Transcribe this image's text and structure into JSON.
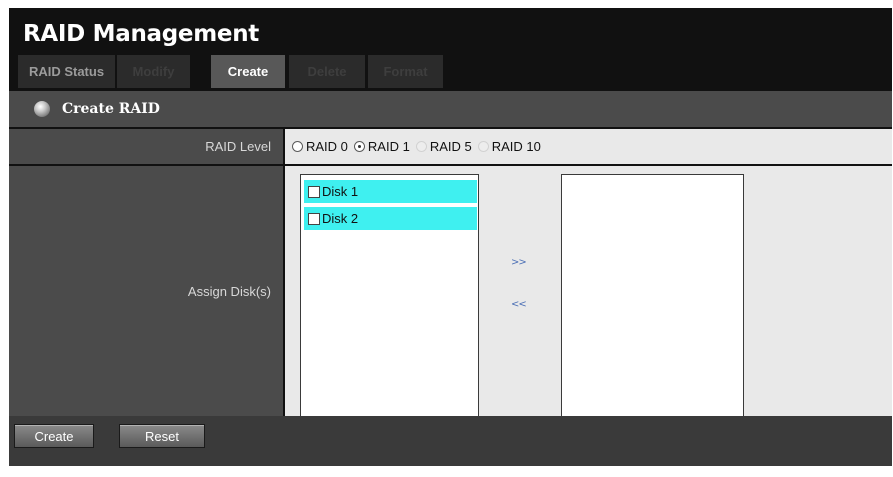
{
  "page": {
    "title": "RAID Management"
  },
  "tabs": [
    {
      "label": "RAID Status",
      "state": "normal"
    },
    {
      "label": "Modify",
      "state": "disabled"
    },
    {
      "label": "Create",
      "state": "active"
    },
    {
      "label": "Delete",
      "state": "disabled"
    },
    {
      "label": "Format",
      "state": "disabled"
    }
  ],
  "section": {
    "title": "Create RAID",
    "icon": "disc-icon"
  },
  "raid_level": {
    "label": "RAID Level",
    "options": [
      {
        "label": "RAID 0",
        "checked": false,
        "disabled": false
      },
      {
        "label": "RAID 1",
        "checked": true,
        "disabled": false
      },
      {
        "label": "RAID 5",
        "checked": false,
        "disabled": true
      },
      {
        "label": "RAID 10",
        "checked": false,
        "disabled": true
      }
    ]
  },
  "assign_disks": {
    "label": "Assign Disk(s)",
    "available": [
      {
        "label": "Disk 1",
        "checked": false
      },
      {
        "label": "Disk 2",
        "checked": false
      }
    ],
    "add_label": ">>",
    "remove_label": "<<"
  },
  "footer": {
    "create_label": "Create",
    "reset_label": "Reset"
  },
  "colors": {
    "accent_highlight": "#3ff0f0",
    "arrow_link": "#4b6fb5",
    "tab_active": "#585858"
  }
}
